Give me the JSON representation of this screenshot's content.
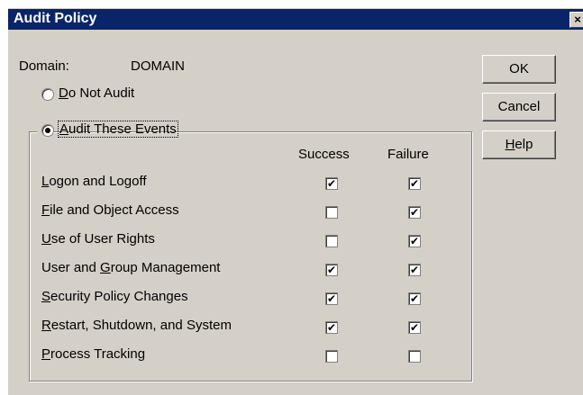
{
  "window": {
    "title": "Audit Policy",
    "close_glyph": "×"
  },
  "domain": {
    "label": "Domain:",
    "value": "DOMAIN"
  },
  "options": {
    "do_not_audit": {
      "mnemonic": "D",
      "rest": "o Not Audit",
      "selected": false
    },
    "audit_these_events": {
      "mnemonic": "A",
      "rest": "udit These Events",
      "selected": true
    }
  },
  "columns": {
    "success": "Success",
    "failure": "Failure"
  },
  "events": [
    {
      "pre": "",
      "mnemonic": "L",
      "post": "ogon and Logoff",
      "success": true,
      "failure": true
    },
    {
      "pre": "",
      "mnemonic": "F",
      "post": "ile and Object Access",
      "success": false,
      "failure": true
    },
    {
      "pre": "",
      "mnemonic": "U",
      "post": "se of User Rights",
      "success": false,
      "failure": true
    },
    {
      "pre": "User and ",
      "mnemonic": "G",
      "post": "roup Management",
      "success": true,
      "failure": true
    },
    {
      "pre": "",
      "mnemonic": "S",
      "post": "ecurity Policy Changes",
      "success": true,
      "failure": true
    },
    {
      "pre": "",
      "mnemonic": "R",
      "post": "estart, Shutdown, and System",
      "success": true,
      "failure": true
    },
    {
      "pre": "",
      "mnemonic": "P",
      "post": "rocess Tracking",
      "success": false,
      "failure": false
    }
  ],
  "buttons": {
    "ok": "OK",
    "cancel": "Cancel",
    "help_mnemonic": "H",
    "help_rest": "elp"
  },
  "check_glyph": "✔"
}
